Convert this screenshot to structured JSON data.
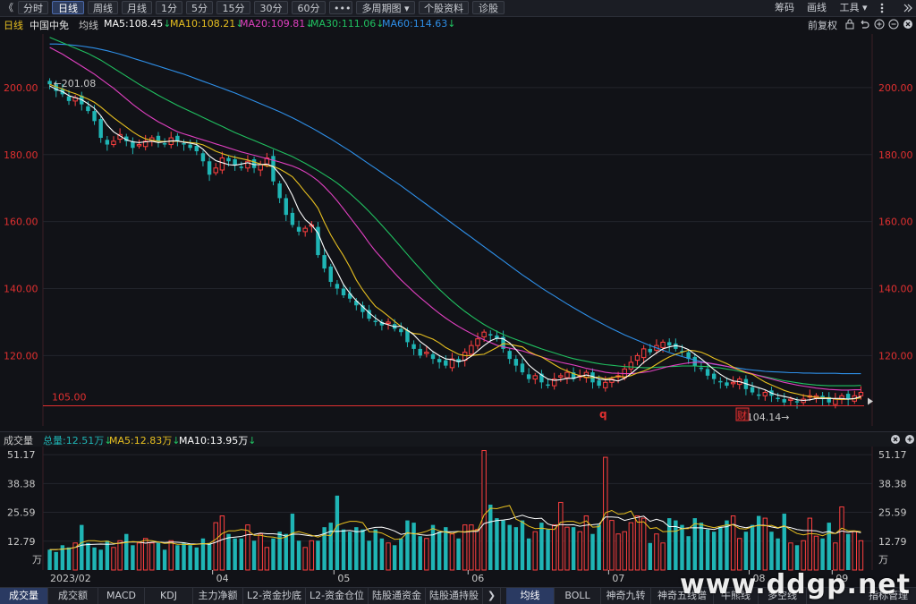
{
  "toolbar": {
    "back": "《",
    "buttons": [
      "分时",
      "日线",
      "周线",
      "月线",
      "1分",
      "5分",
      "15分",
      "30分",
      "60分",
      "•••",
      "多周期图 ▾",
      "个股资料",
      "诊股"
    ],
    "active": "日线",
    "right": [
      "筹码",
      "画线",
      "工具 ▾"
    ]
  },
  "ma_info": {
    "period": "日线",
    "name": "中国中免",
    "label": "均线",
    "ma5": "MA5:108.45",
    "ma10": "MA10:108.21",
    "ma20": "MA20:109.81",
    "ma30": "MA30:111.06",
    "ma60": "MA60:114.63",
    "restore": "前复权"
  },
  "colors": {
    "up": "#ff4040",
    "down": "#1fb5b5",
    "ma5": "#ffffff",
    "ma10": "#e8c020",
    "ma20": "#e040c0",
    "ma30": "#20c060",
    "ma60": "#2e8fe8",
    "axis": "#e03030"
  },
  "chart_data": {
    "type": "candlestick",
    "price_axis": {
      "ticks": [
        "200.00",
        "180.00",
        "160.00",
        "140.00",
        "120.00"
      ],
      "values": [
        200,
        180,
        160,
        140,
        120
      ],
      "range": [
        99,
        216
      ]
    },
    "annotations": {
      "high_label": "201.08",
      "low_label": "104.14",
      "line_value": 105.0,
      "line_label": "105.00",
      "marker_q": "q",
      "marker_cai": "财"
    },
    "months": [
      "2023/02",
      "04",
      "05",
      "06",
      "07",
      "08",
      "09"
    ],
    "close": [
      201,
      199,
      198,
      196,
      197,
      195,
      193,
      190,
      185,
      183,
      184,
      186,
      184,
      182,
      183,
      184,
      185,
      184,
      183,
      185,
      184,
      183,
      182,
      181,
      178,
      174,
      176,
      179,
      178,
      177,
      176,
      178,
      176,
      177,
      179,
      172,
      167,
      162,
      159,
      157,
      158,
      159,
      150,
      146,
      142,
      140,
      138,
      137,
      135,
      133,
      131,
      130,
      129,
      130,
      128,
      127,
      124,
      122,
      120,
      121,
      119,
      118,
      117,
      119,
      118,
      121,
      123,
      125,
      127,
      126,
      125,
      122,
      119,
      117,
      115,
      113,
      114,
      112,
      111,
      113,
      114,
      115,
      113,
      114,
      115,
      112,
      111,
      112,
      113,
      114,
      116,
      118,
      120,
      122,
      121,
      123,
      124,
      123,
      122,
      121,
      119,
      117,
      116,
      114,
      113,
      112,
      111,
      112,
      113,
      110,
      109,
      108,
      109,
      108,
      107,
      106,
      107,
      106,
      107,
      108,
      108,
      107,
      106,
      107,
      108,
      107,
      108,
      109
    ],
    "ma5": [
      200.5,
      199.5,
      198.8,
      197.6,
      197.0,
      196.4,
      195.2,
      193.8,
      191.6,
      188.8,
      186.8,
      185.6,
      184.4,
      183.8,
      183.6,
      183.8,
      184.0,
      183.6,
      183.8,
      184.1,
      184.1,
      183.7,
      183.4,
      183.0,
      181.6,
      179.6,
      178.2,
      177.6,
      177.0,
      176.8,
      177.2,
      177.6,
      177.0,
      177.0,
      177.2,
      176.4,
      174.2,
      171.4,
      167.8,
      163.4,
      160.6,
      159.0,
      156.6,
      152.0,
      148.6,
      145.0,
      141.2,
      138.6,
      136.4,
      134.6,
      132.8,
      131.2,
      129.8,
      129.2,
      128.6,
      128.8,
      127.6,
      126.2,
      124.2,
      122.8,
      121.2,
      120.0,
      119.0,
      118.8,
      118.2,
      118.6,
      119.8,
      121.4,
      123.0,
      124.4,
      125.2,
      125.0,
      123.8,
      121.8,
      119.6,
      117.2,
      115.6,
      114.2,
      113.0,
      112.6,
      112.8,
      113.2,
      113.2,
      113.8,
      114.2,
      113.8,
      113.0,
      112.8,
      112.8,
      112.4,
      113.2,
      114.6,
      116.2,
      118.0,
      119.4,
      120.8,
      122.0,
      122.6,
      123.0,
      122.6,
      121.8,
      120.4,
      119.0,
      117.4,
      115.8,
      114.4,
      113.2,
      112.4,
      112.2,
      111.6,
      111.0,
      110.4,
      109.8,
      108.8,
      108.2,
      107.8,
      107.4,
      106.8,
      106.6,
      106.8,
      107.2,
      107.2,
      107.2,
      107.2,
      107.2,
      107.0,
      107.2,
      107.8
    ],
    "ma10": [
      201.0,
      200.2,
      199.6,
      198.8,
      198.2,
      197.4,
      196.6,
      195.6,
      194.2,
      192.6,
      191.0,
      189.6,
      188.2,
      186.8,
      185.6,
      184.7,
      184.3,
      184.0,
      183.9,
      184.0,
      184.0,
      183.8,
      183.6,
      183.4,
      182.9,
      182.0,
      181.0,
      180.3,
      179.7,
      179.2,
      178.8,
      178.4,
      177.8,
      177.2,
      176.6,
      176.5,
      175.7,
      174.6,
      173.4,
      171.2,
      168.8,
      166.6,
      164.0,
      159.8,
      156.0,
      152.8,
      149.8,
      146.4,
      142.6,
      139.6,
      137.0,
      134.7,
      133.3,
      131.8,
      130.2,
      128.7,
      127.4,
      126.6,
      126.4,
      125.6,
      124.9,
      123.8,
      122.4,
      121.4,
      120.4,
      120.0,
      120.0,
      120.2,
      120.4,
      121.4,
      122.4,
      123.6,
      123.4,
      123.0,
      122.6,
      121.2,
      120.3,
      119.6,
      118.5,
      117.3,
      116.2,
      115.4,
      114.6,
      114.0,
      113.5,
      113.4,
      113.6,
      113.0,
      113.4,
      113.8,
      113.6,
      114.0,
      114.8,
      115.4,
      116.2,
      117.4,
      118.6,
      119.6,
      120.4,
      121.0,
      121.6,
      121.4,
      121.0,
      120.2,
      119.2,
      118.4,
      117.6,
      116.6,
      115.7,
      114.9,
      114.4,
      113.2,
      112.1,
      111.2,
      110.4,
      109.6,
      109.0,
      108.6,
      108.1,
      107.8,
      107.6,
      107.4,
      107.4,
      107.0,
      106.9,
      107.0,
      107.1,
      107.4
    ],
    "ma20": [
      212.0,
      211.0,
      210.0,
      208.8,
      207.6,
      206.4,
      205.2,
      204.0,
      202.6,
      201.2,
      199.8,
      198.2,
      196.6,
      195.0,
      193.6,
      192.2,
      191.0,
      189.8,
      188.8,
      187.8,
      186.8,
      186.2,
      185.6,
      185.0,
      184.4,
      183.8,
      183.2,
      182.6,
      182.0,
      181.4,
      180.8,
      180.3,
      179.8,
      179.3,
      178.8,
      178.3,
      177.8,
      177.2,
      176.6,
      175.8,
      174.8,
      173.6,
      172.2,
      170.4,
      168.4,
      166.2,
      163.8,
      161.3,
      158.8,
      156.3,
      153.6,
      151.2,
      149.0,
      146.8,
      144.6,
      142.6,
      140.8,
      139.0,
      137.3,
      135.7,
      134.1,
      132.6,
      131.2,
      129.9,
      128.7,
      127.6,
      126.6,
      125.6,
      124.7,
      123.9,
      123.1,
      122.6,
      122.2,
      121.8,
      121.4,
      120.8,
      120.2,
      119.6,
      119.0,
      118.5,
      118.0,
      117.6,
      117.2,
      116.7,
      116.2,
      115.8,
      115.4,
      115.0,
      114.8,
      114.7,
      114.6,
      114.6,
      114.8,
      115.0,
      115.3,
      115.8,
      116.3,
      116.8,
      117.2,
      117.5,
      117.8,
      118.0,
      118.0,
      117.8,
      117.5,
      117.2,
      116.8,
      116.3,
      115.7,
      115.1,
      114.6,
      114.0,
      113.5,
      113.0,
      112.5,
      112.0,
      111.6,
      111.2,
      110.9,
      110.6,
      110.3,
      110.1,
      109.9,
      109.8,
      109.7,
      109.7,
      109.8,
      109.8
    ],
    "ma30": [
      215.0,
      214.2,
      213.4,
      212.6,
      211.8,
      211.0,
      210.2,
      209.2,
      208.2,
      207.0,
      205.8,
      204.6,
      203.4,
      202.2,
      201.0,
      199.9,
      198.8,
      197.7,
      196.7,
      195.7,
      194.7,
      193.8,
      192.9,
      192.0,
      191.1,
      190.2,
      189.3,
      188.4,
      187.5,
      186.6,
      185.8,
      185.0,
      184.2,
      183.4,
      182.6,
      181.8,
      181.0,
      180.2,
      179.4,
      178.4,
      177.4,
      176.3,
      175.2,
      174.0,
      172.8,
      171.5,
      170.0,
      168.4,
      166.7,
      164.9,
      163.0,
      161.0,
      158.9,
      156.8,
      154.6,
      152.4,
      150.2,
      148.0,
      145.9,
      143.8,
      141.7,
      139.8,
      138.0,
      136.3,
      134.7,
      133.2,
      131.8,
      130.5,
      129.3,
      128.2,
      127.2,
      126.3,
      125.5,
      124.8,
      124.1,
      123.4,
      122.7,
      122.0,
      121.4,
      120.8,
      120.2,
      119.6,
      119.1,
      118.7,
      118.3,
      117.9,
      117.6,
      117.3,
      117.1,
      116.9,
      116.7,
      116.6,
      116.5,
      116.4,
      116.4,
      116.5,
      116.6,
      116.7,
      116.8,
      116.9,
      116.9,
      116.9,
      116.8,
      116.7,
      116.5,
      116.3,
      116.0,
      115.7,
      115.3,
      114.9,
      114.5,
      114.1,
      113.7,
      113.3,
      112.9,
      112.5,
      112.2,
      111.9,
      111.6,
      111.4,
      111.2,
      111.1,
      111.0,
      111.0,
      111.0,
      111.0,
      111.0,
      111.1
    ],
    "ma60": [
      213.0,
      213.0,
      212.9,
      212.8,
      212.6,
      212.4,
      212.1,
      211.8,
      211.4,
      211.0,
      210.5,
      210.0,
      209.4,
      208.8,
      208.2,
      207.6,
      207.0,
      206.4,
      205.8,
      205.2,
      204.6,
      204.0,
      203.3,
      202.6,
      201.9,
      201.2,
      200.5,
      199.8,
      199.1,
      198.4,
      197.6,
      196.8,
      196.0,
      195.2,
      194.4,
      193.6,
      192.8,
      191.9,
      191.0,
      190.0,
      189.0,
      188.0,
      186.9,
      185.8,
      184.7,
      183.5,
      182.3,
      181.1,
      179.8,
      178.5,
      177.2,
      175.9,
      174.6,
      173.3,
      172.0,
      170.7,
      169.3,
      167.9,
      166.5,
      165.1,
      163.7,
      162.3,
      160.9,
      159.5,
      158.1,
      156.7,
      155.3,
      153.9,
      152.5,
      151.1,
      149.7,
      148.3,
      146.9,
      145.5,
      144.1,
      142.8,
      141.5,
      140.2,
      139.0,
      137.8,
      136.6,
      135.4,
      134.3,
      133.2,
      132.1,
      131.0,
      130.0,
      129.0,
      128.0,
      127.1,
      126.2,
      125.4,
      124.6,
      123.8,
      123.0,
      122.3,
      121.6,
      120.9,
      120.3,
      119.7,
      119.2,
      118.7,
      118.2,
      117.8,
      117.4,
      117.1,
      116.8,
      116.5,
      116.2,
      115.9,
      115.7,
      115.5,
      115.3,
      115.2,
      115.1,
      115.0,
      114.9,
      114.9,
      114.8,
      114.8,
      114.7,
      114.7,
      114.7,
      114.7,
      114.6,
      114.6,
      114.6,
      114.6
    ],
    "volume_axis": {
      "ticks": [
        "51.17",
        "38.38",
        "25.59",
        "12.79",
        "万"
      ],
      "values": [
        51.17,
        38.38,
        25.59,
        12.79,
        0
      ],
      "range": [
        0,
        54
      ]
    },
    "volume_info": {
      "label": "成交量",
      "total": "总量:12.51万",
      "ma5": "MA5:12.83万",
      "ma10": "MA10:13.95万"
    },
    "volume": [
      9,
      8,
      11,
      10,
      12,
      20,
      12,
      10,
      9,
      13,
      10,
      13,
      16,
      11,
      12,
      14,
      12,
      12,
      9,
      13,
      11,
      12,
      11,
      10,
      14,
      12,
      21,
      24,
      16,
      14,
      14,
      20,
      13,
      16,
      10,
      14,
      17,
      16,
      25,
      13,
      10,
      13,
      13,
      19,
      21,
      33,
      18,
      17,
      19,
      18,
      13,
      18,
      14,
      12,
      11,
      14,
      22,
      21,
      15,
      14,
      20,
      17,
      19,
      16,
      14,
      20,
      20,
      18,
      53,
      29,
      23,
      22,
      20,
      19,
      22,
      14,
      17,
      21,
      18,
      20,
      30,
      19,
      19,
      17,
      24,
      16,
      20,
      50,
      22,
      16,
      17,
      21,
      24,
      23,
      12,
      16,
      12,
      23,
      22,
      20,
      15,
      23,
      21,
      18,
      17,
      19,
      22,
      24,
      14,
      17,
      20,
      24,
      23,
      17,
      14,
      25,
      12,
      11,
      13,
      23,
      15,
      14,
      21,
      12,
      28,
      16,
      17,
      13
    ],
    "vol_ma5": [
      9,
      9,
      9.3,
      9.5,
      10,
      12.2,
      13,
      13,
      12.6,
      12.8,
      11.8,
      11.8,
      12.2,
      12.6,
      12.4,
      13.2,
      13,
      12.4,
      11.8,
      12,
      11.4,
      11.4,
      11.2,
      11.4,
      11.6,
      11.8,
      13.6,
      16.2,
      17.4,
      17.4,
      18,
      17.6,
      15.4,
      15.4,
      14.8,
      14.6,
      14,
      14.6,
      16.4,
      17,
      16.2,
      15.4,
      14.6,
      15.6,
      15.2,
      19.8,
      20.8,
      21.6,
      21.6,
      21.0,
      17.0,
      17.0,
      16.4,
      15.0,
      13.6,
      13.8,
      16.6,
      16.0,
      16.4,
      17.2,
      18.4,
      17.4,
      16.8,
      16.2,
      17.0,
      17.0,
      17.4,
      17.6,
      24.4,
      27.4,
      27.2,
      28.0,
      28.6,
      22.6,
      21.2,
      19.4,
      18.4,
      18.6,
      18.2,
      18.0,
      21.2,
      21.6,
      21.6,
      20.6,
      21.8,
      19.0,
      19.2,
      25.4,
      26.4,
      24.8,
      25.0,
      26.2,
      21.2,
      21.4,
      18.4,
      18.8,
      17.0,
      17.2,
      17.2,
      18.4,
      18.4,
      20.6,
      20.2,
      19.4,
      18.8,
      19.4,
      20.0,
      20.0,
      18.4,
      18.2,
      19.2,
      19.8,
      19.6,
      19.8,
      18.8,
      19.6,
      17.8,
      16.2,
      15.6,
      16.2,
      16.0,
      15.2,
      16.4,
      16.2,
      18.6,
      17.4,
      17.4,
      17.0
    ],
    "vol_ma10": [
      9,
      9,
      9.3,
      9.5,
      10,
      11,
      11.3,
      11.4,
      11.5,
      11.4,
      11.5,
      12,
      12.4,
      12.4,
      12.4,
      11.9,
      12.3,
      12.4,
      12.2,
      12.4,
      12.3,
      12.1,
      11.6,
      11.5,
      11.7,
      11.4,
      12.3,
      13.5,
      14.3,
      14.6,
      14.9,
      15.7,
      15.8,
      16.4,
      16.1,
      16.1,
      15.8,
      15.0,
      15.9,
      15.9,
      15.5,
      15.1,
      15.3,
      16.1,
      17.2,
      17.1,
      17.3,
      17.6,
      17.0,
      17.2,
      18.4,
      18.9,
      19.0,
      18.3,
      17.3,
      15.8,
      16.4,
      16.2,
      15.7,
      15.4,
      15.6,
      16.7,
      17.0,
      16.9,
      17.1,
      16.8,
      17.1,
      17.1,
      20.6,
      21.4,
      21.9,
      22.2,
      22.6,
      23.5,
      24.3,
      23.3,
      22.8,
      23.0,
      20.4,
      19.6,
      20.2,
      20.0,
      20.1,
      19.4,
      19.9,
      20.1,
      20.4,
      23.5,
      23.5,
      23.3,
      22.0,
      22.7,
      23.3,
      23.9,
      21.6,
      22.5,
      21.6,
      19.2,
      19.3,
      18.4,
      18.7,
      18.7,
      18.7,
      18.3,
      18.0,
      18.9,
      19.2,
      20.3,
      19.3,
      18.8,
      19.3,
      19.9,
      19.8,
      19.1,
      18.6,
      19.4,
      18.8,
      18.0,
      17.6,
      17.5,
      17.4,
      16.5,
      17.1,
      16.2,
      17.3,
      16.7,
      17.2,
      16.6
    ]
  },
  "tabs": {
    "bottom_left": [
      "成交量",
      "成交额",
      "MACD",
      "KDJ",
      "主力净额",
      "L2-资金抄底",
      "L2-资金仓位",
      "陆股通资金",
      "陆股通持股"
    ],
    "arrow": "❯",
    "bottom_right": [
      "均线",
      "BOLL",
      "神奇九转",
      "神奇五线谱",
      "牛熊线",
      "多空线",
      "指标管理"
    ],
    "active_left": "成交量",
    "active_right": "均线"
  },
  "watermark": "www.ddgp.net"
}
